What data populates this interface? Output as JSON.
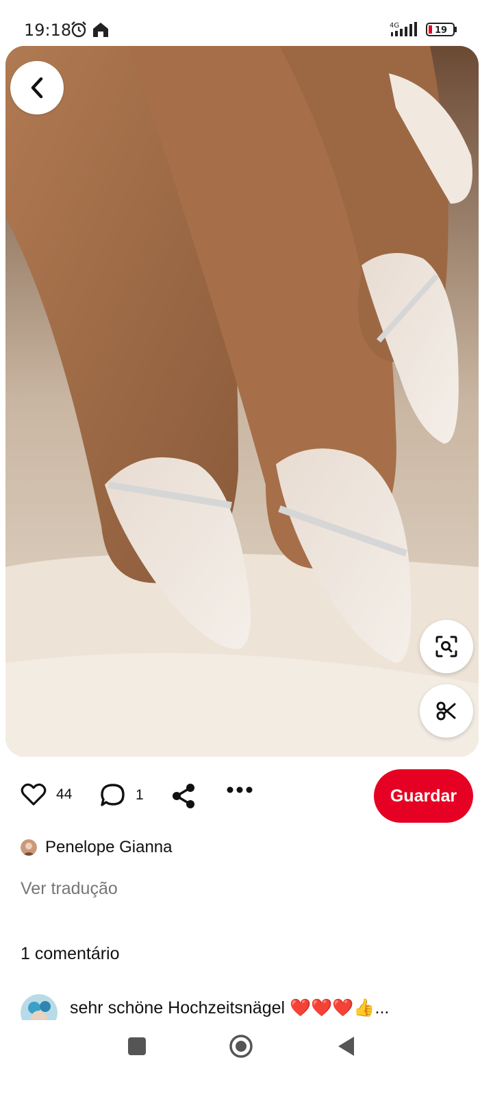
{
  "status_bar": {
    "time": "19:18",
    "network": "4G",
    "battery": "19",
    "icons": [
      "alarm-icon",
      "home-icon",
      "signal-icon",
      "battery-icon"
    ]
  },
  "pin": {
    "image_alt": "",
    "actions": {
      "like_count": "44",
      "comment_count": "1",
      "save_label": "Guardar"
    },
    "author": "Penelope Gianna",
    "translate_link": "Ver tradução",
    "comments_heading": "1 comentário",
    "comments": [
      {
        "text": "sehr schöne Hochzeitsnägel ❤️❤️❤️👍..."
      }
    ]
  },
  "colors": {
    "accent": "#e60023",
    "muted_text": "#767676"
  }
}
